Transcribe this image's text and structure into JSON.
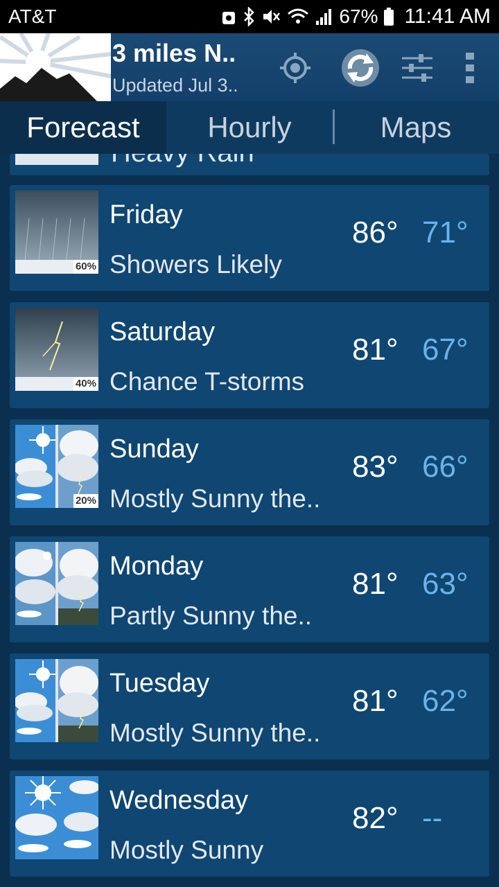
{
  "status_bar": {
    "carrier": "AT&T",
    "battery": "67%",
    "time": "11:41 AM"
  },
  "header": {
    "location": "3 miles N..",
    "updated": "Updated Jul 3.."
  },
  "tabs": [
    {
      "label": "Forecast",
      "active": true
    },
    {
      "label": "Hourly",
      "active": false
    },
    {
      "label": "Maps",
      "active": false
    }
  ],
  "partial_row": {
    "condition": "Heavy Rain"
  },
  "days": [
    {
      "day": "Friday",
      "condition": "Showers Likely",
      "hi": "86°",
      "lo": "71°",
      "pop": "60%",
      "icon": "rain-icon"
    },
    {
      "day": "Saturday",
      "condition": "Chance T-storms",
      "hi": "81°",
      "lo": "67°",
      "pop": "40%",
      "icon": "thunderstorm-icon"
    },
    {
      "day": "Sunday",
      "condition": "Mostly Sunny the..",
      "hi": "83°",
      "lo": "66°",
      "pop": "20%",
      "icon": "sun-then-storm-icon"
    },
    {
      "day": "Monday",
      "condition": "Partly Sunny the..",
      "hi": "81°",
      "lo": "63°",
      "pop": "",
      "icon": "partly-sunny-then-storm-icon"
    },
    {
      "day": "Tuesday",
      "condition": "Mostly Sunny the..",
      "hi": "81°",
      "lo": "62°",
      "pop": "",
      "icon": "sun-then-storm-icon"
    },
    {
      "day": "Wednesday",
      "condition": "Mostly Sunny",
      "hi": "82°",
      "lo": "--",
      "pop": "",
      "icon": "mostly-sunny-icon"
    }
  ],
  "colors": {
    "accent_low_temp": "#6bb3e8",
    "card_bg": "#0f4672"
  }
}
